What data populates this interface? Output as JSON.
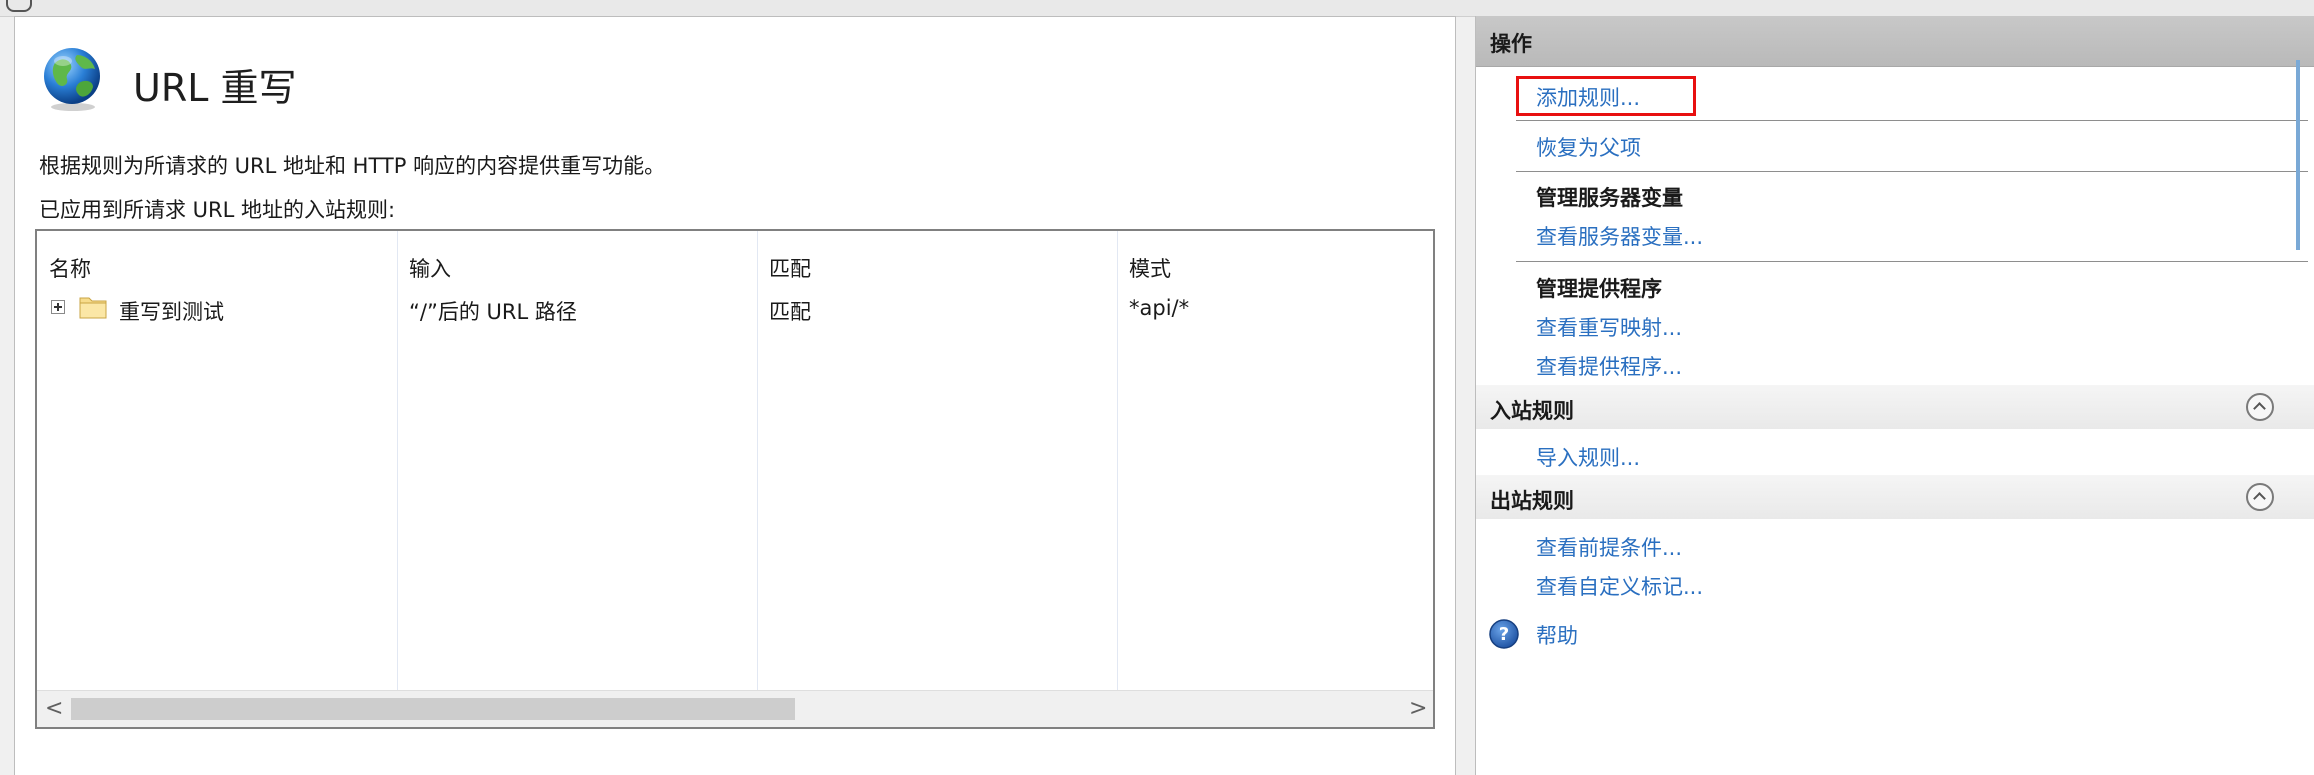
{
  "feature": {
    "title": "URL 重写",
    "description": "根据规则为所请求的 URL 地址和 HTTP 响应的内容提供重写功能。",
    "subheading": "已应用到所请求 URL 地址的入站规则:"
  },
  "grid": {
    "columns": [
      "名称",
      "输入",
      "匹配",
      "模式"
    ],
    "rows": [
      {
        "name": "重写到测试",
        "input": "“/”后的 URL 路径",
        "match": "匹配",
        "pattern": "*api/*"
      }
    ],
    "scroll_left": "<",
    "scroll_right": ">"
  },
  "actions": {
    "header": "操作",
    "add_rule": "添加规则...",
    "revert_parent": "恢复为父项",
    "server_vars_title": "管理服务器变量",
    "view_server_vars": "查看服务器变量...",
    "providers_title": "管理提供程序",
    "view_rewrite_maps": "查看重写映射...",
    "view_providers": "查看提供程序...",
    "inbound_title": "入站规则",
    "import_rules": "导入规则...",
    "outbound_title": "出站规则",
    "view_preconditions": "查看前提条件...",
    "view_custom_tags": "查看自定义标记...",
    "help": "帮助"
  },
  "colors": {
    "link": "#2a6fc0",
    "highlight": "#e81010"
  },
  "icons": [
    "globe-icon",
    "folder-icon",
    "expand-icon",
    "collapse-icon",
    "help-icon"
  ]
}
